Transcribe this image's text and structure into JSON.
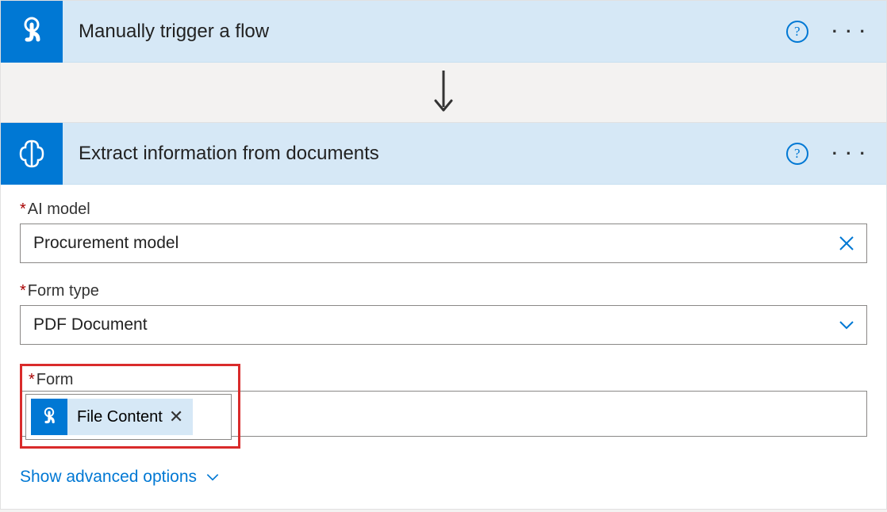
{
  "trigger": {
    "title": "Manually trigger a flow",
    "icon": "touch-icon"
  },
  "action": {
    "title": "Extract information from documents",
    "icon": "ai-brain-icon"
  },
  "fields": {
    "aiModel": {
      "label": "AI model",
      "value": "Procurement model"
    },
    "formType": {
      "label": "Form type",
      "value": "PDF Document"
    },
    "form": {
      "label": "Form",
      "tokenLabel": "File Content",
      "tokenIcon": "touch-icon"
    }
  },
  "advancedLink": "Show advanced options"
}
